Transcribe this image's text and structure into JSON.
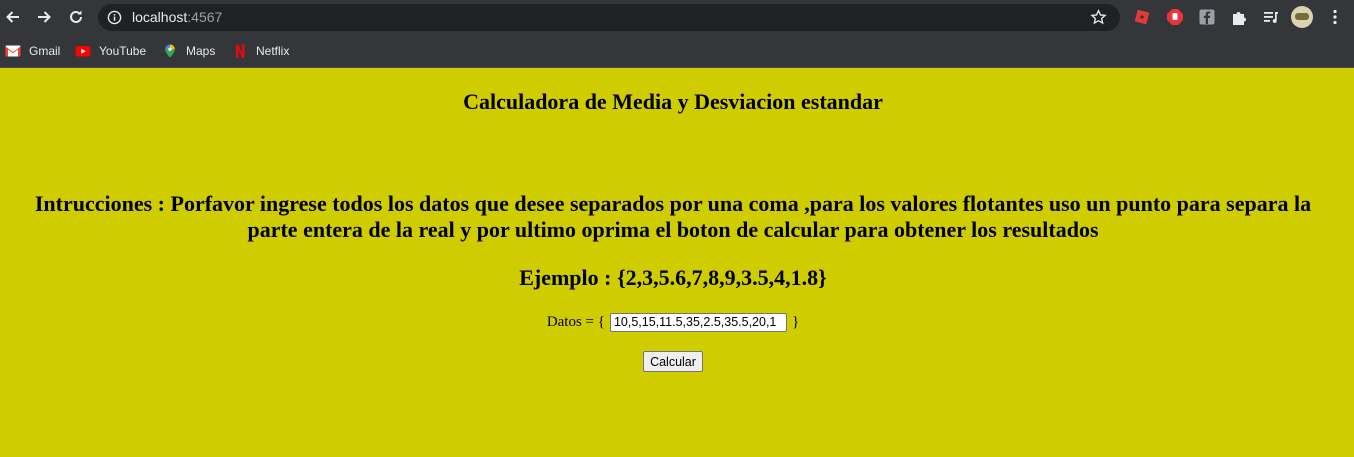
{
  "browser": {
    "url_host": "localhost",
    "url_port": ":4567",
    "bookmarks": [
      {
        "label": "Gmail",
        "icon": "gmail-icon"
      },
      {
        "label": "YouTube",
        "icon": "youtube-icon"
      },
      {
        "label": "Maps",
        "icon": "maps-icon"
      },
      {
        "label": "Netflix",
        "icon": "netflix-icon"
      }
    ]
  },
  "page": {
    "background": "#cfcd00",
    "title": "Calculadora de Media y Desviacion estandar",
    "instructions": "Intrucciones : Porfavor ingrese todos los datos que desee separados por una coma ,para los valores flotantes uso un punto para separa la parte entera de la real y por ultimo oprima el boton de calcular para obtener los resultados",
    "example": "Ejemplo : {2,3,5.6,7,8,9,3.5,4,1.8}",
    "datos_prefix": "Datos = {",
    "datos_suffix": "}",
    "datos_value": "10,5,15,11.5,35,2.5,35.5,20,1",
    "calculate_label": "Calcular"
  }
}
